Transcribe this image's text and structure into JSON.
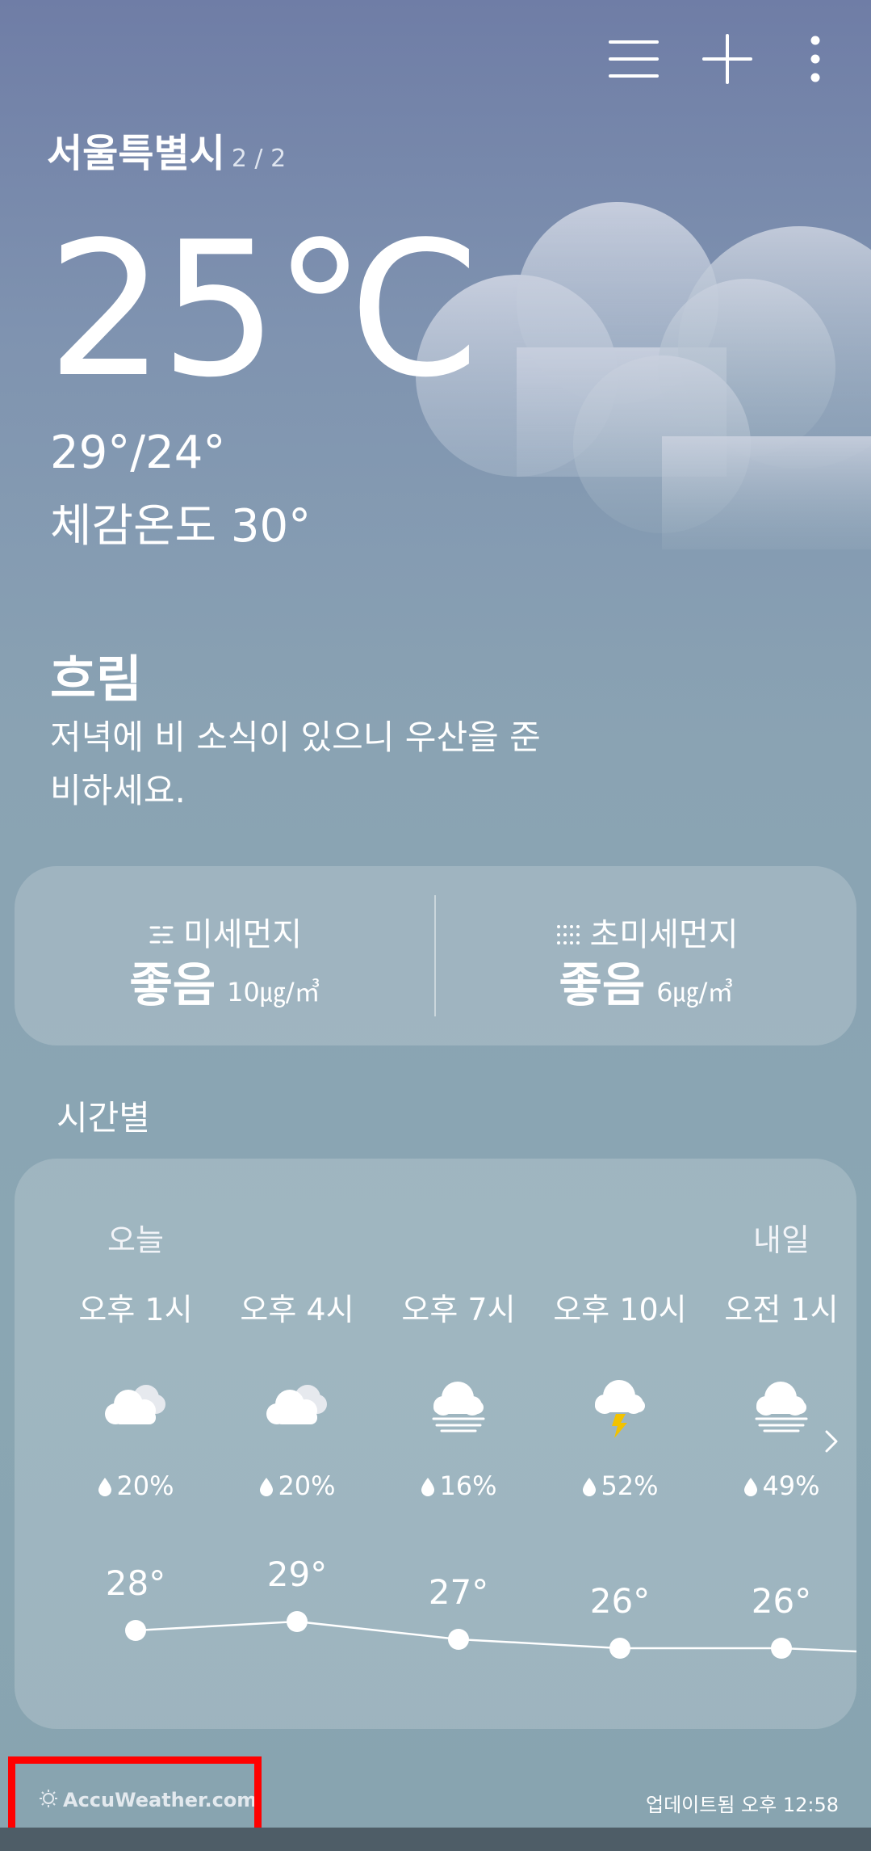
{
  "location": {
    "city": "서울특별시",
    "page": "2 / 2"
  },
  "current": {
    "temperature": "25℃",
    "hilo": "29°/24°",
    "feels_like": "체감온도 30°",
    "condition": "흐림",
    "advice": "저녁에 비 소식이 있으니 우산을 준비하세요."
  },
  "air": {
    "pm10": {
      "label": "미세먼지",
      "grade": "좋음",
      "value": "10㎍/㎥"
    },
    "pm25": {
      "label": "초미세먼지",
      "grade": "좋음",
      "value": "6㎍/㎥"
    }
  },
  "hourly": {
    "title": "시간별",
    "today_label": "오늘",
    "tomorrow_label": "내일",
    "items": [
      {
        "time": "오후 1시",
        "icon": "partly-cloudy-icon",
        "precip": "20%",
        "temp": "28°",
        "temp_value": 28
      },
      {
        "time": "오후 4시",
        "icon": "partly-cloudy-icon",
        "precip": "20%",
        "temp": "29°",
        "temp_value": 29
      },
      {
        "time": "오후 7시",
        "icon": "fog-cloud-icon",
        "precip": "16%",
        "temp": "27°",
        "temp_value": 27
      },
      {
        "time": "오후 10시",
        "icon": "thunderstorm-icon",
        "precip": "52%",
        "temp": "26°",
        "temp_value": 26
      },
      {
        "time": "오전 1시",
        "icon": "fog-cloud-icon",
        "precip": "49%",
        "temp": "26°",
        "temp_value": 26
      }
    ]
  },
  "footer": {
    "source": "AccuWeather.com",
    "updated": "업데이트됨 오후 12:58"
  },
  "colors": {
    "highlight": "#ff0000",
    "lightning": "#f2c200"
  }
}
